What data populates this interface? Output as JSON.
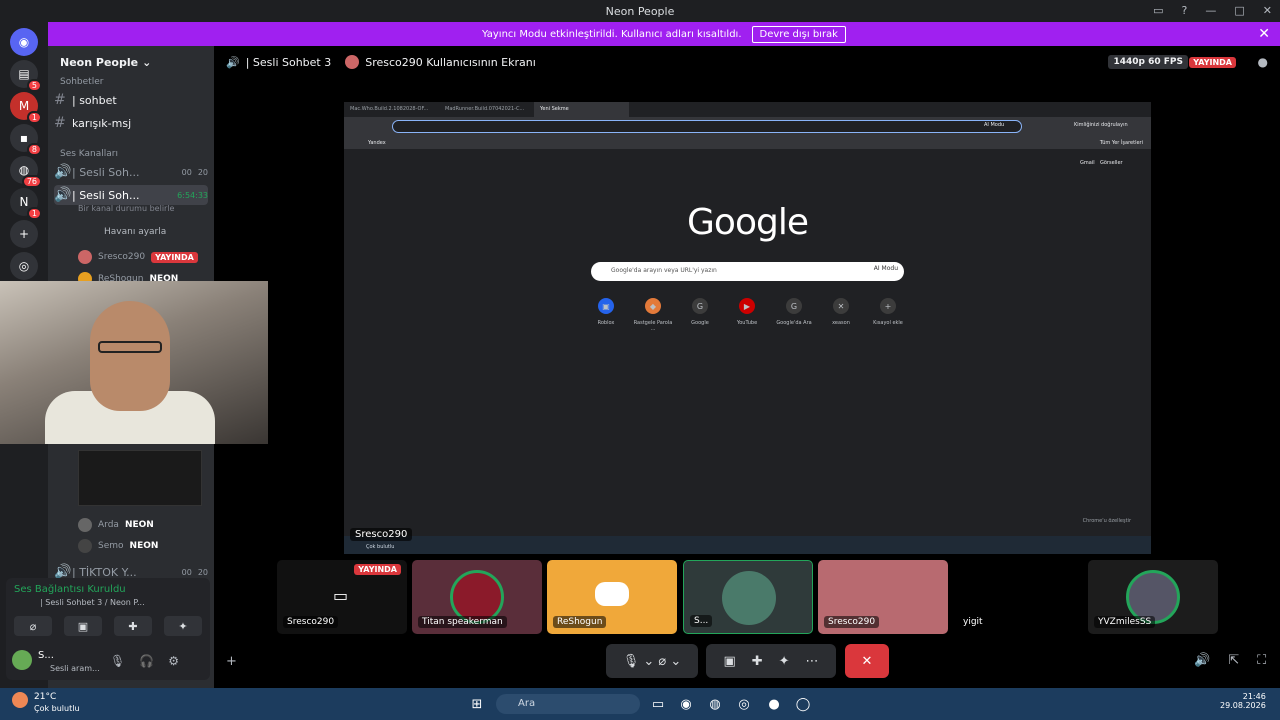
{
  "window": {
    "title": "Neon People"
  },
  "banner": {
    "text": "Yayıncı Modu etkinleştirildi. Kullanıcı adları kısaltıldı.",
    "button": "Devre dışı bırak"
  },
  "server": {
    "name": "Neon People"
  },
  "channels": {
    "cat_text": "Sohbetler",
    "sohbet": "| sohbet",
    "karisik": "karışık-msj",
    "cat_voice": "Ses Kanalları",
    "voice1": "| Sesli Soh...",
    "voice1_count": "00",
    "voice1_limit": "20",
    "voice2": "| Sesli Soh...",
    "voice2_time": "6:54:33",
    "voice2_status": "Bir kanal durumu belirle",
    "avatar_btn": "Havanı ayarla",
    "tiktok": "| TİKTOK Y...",
    "tiktok_count": "00",
    "tiktok_limit": "20"
  },
  "members": [
    {
      "name": "Sresco290",
      "badge": "YAYINDA"
    },
    {
      "name": "ReShogun",
      "tag": "NEON"
    },
    {
      "name": "Arda",
      "tag": "NEON"
    },
    {
      "name": "Semo",
      "tag": "NEON"
    }
  ],
  "voicepanel": {
    "status": "Ses Bağlantısı Kuruldu",
    "channel": "| Sesli Sohbet 3 / Neon P...",
    "user": "S...",
    "user_status": "Sesli aram..."
  },
  "mainheader": {
    "channel": "| Sesli Sohbet 3",
    "screen": "Sresco290 Kullanıcısının Ekranı",
    "quality": "1440p 60 FPS",
    "live": "YAYINDA"
  },
  "chrome": {
    "tabs": [
      "Mac.Who.Build.2.1082028-OF...",
      "MadRunner.Build.07042021-C...",
      "Yeni Sekme"
    ],
    "ai_mode": "AI Modu",
    "verify": "Kimliğinizi doğrulayın",
    "bookmark": "Yandex",
    "all_bookmarks": "Tüm Yer İşaretleri",
    "gmail": "Gmail",
    "images": "Görseller",
    "logo": "Google",
    "search_placeholder": "Google'da arayın veya URL'yi yazın",
    "shortcuts": [
      "Roblox",
      "Rastgele Parola ...",
      "Google",
      "YouTube",
      "Google'da Ara",
      "xeason",
      "Kısayol ekle"
    ],
    "customize": "Chrome'u özelleştir"
  },
  "stream_label": "Sresco290",
  "stream_sub": "Çok bulutlu",
  "tiles": [
    {
      "name": "Sresco290",
      "live": "YAYINDA"
    },
    {
      "name": "Titan speakerman"
    },
    {
      "name": "ReShogun"
    },
    {
      "name": "S..."
    },
    {
      "name": "Sresco290"
    },
    {
      "name": "yigit"
    },
    {
      "name": "YVZmilesSS"
    }
  ],
  "taskbar": {
    "weather": "21°C",
    "weather_desc": "Çok bulutlu",
    "search": "Ara",
    "time": "21:46",
    "date": "29.08.2026"
  },
  "colors": {
    "accent": "#a020f0",
    "live": "#da373c",
    "blurple": "#5865f2"
  }
}
